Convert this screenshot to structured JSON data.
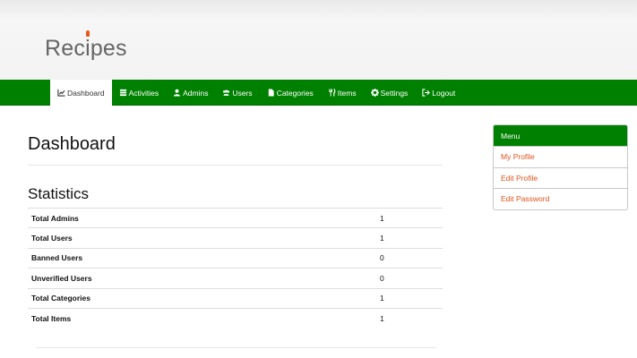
{
  "brand": {
    "logo_text_before": "Rec",
    "logo_i": "i",
    "logo_text_after": "pes",
    "accent_color": "#e85a1b"
  },
  "theme": {
    "primary_color": "#008000",
    "link_color": "#e0531c"
  },
  "nav": {
    "items": [
      {
        "label": "Dashboard",
        "icon": "line-chart-icon",
        "active": true
      },
      {
        "label": "Activities",
        "icon": "list-icon"
      },
      {
        "label": "Admins",
        "icon": "user-icon"
      },
      {
        "label": "Users",
        "icon": "users-icon"
      },
      {
        "label": "Categories",
        "icon": "file-icon"
      },
      {
        "label": "Items",
        "icon": "cutlery-icon"
      },
      {
        "label": "Settings",
        "icon": "gear-icon"
      },
      {
        "label": "Logout",
        "icon": "sign-out-icon"
      }
    ]
  },
  "main": {
    "title": "Dashboard",
    "statistics": {
      "title": "Statistics",
      "rows": [
        {
          "label": "Total Admins",
          "value": "1"
        },
        {
          "label": "Total Users",
          "value": "1"
        },
        {
          "label": "Banned Users",
          "value": "0"
        },
        {
          "label": "Unverified Users",
          "value": "0"
        },
        {
          "label": "Total Categories",
          "value": "1"
        },
        {
          "label": "Total Items",
          "value": "1"
        }
      ]
    }
  },
  "sidebar": {
    "heading": "Menu",
    "links": [
      {
        "label": "My Profile"
      },
      {
        "label": "Edit Profile"
      },
      {
        "label": "Edit Password"
      }
    ]
  }
}
